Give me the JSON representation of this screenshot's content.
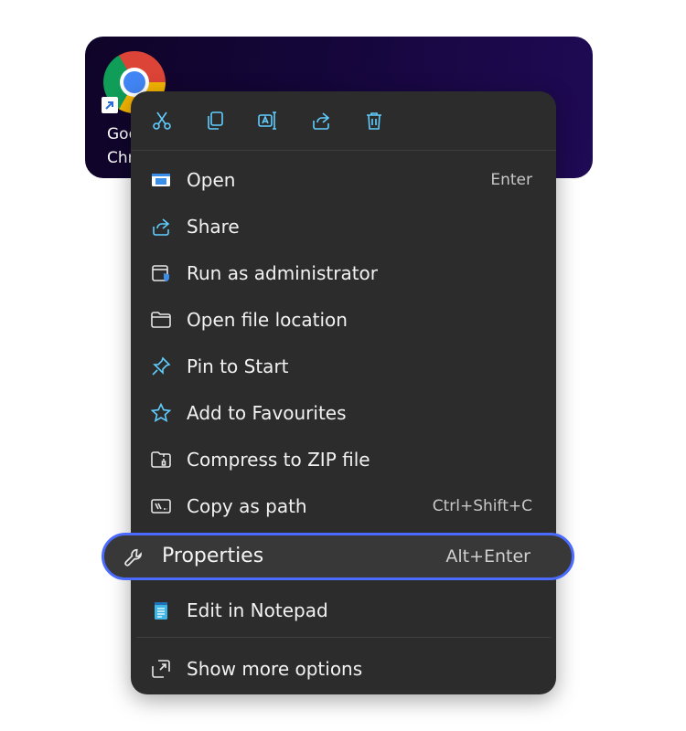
{
  "desktop": {
    "icon_name": "chrome-icon",
    "label_line1": "Goo",
    "label_line2": "Chr"
  },
  "quick_actions": [
    {
      "name": "cut",
      "icon": "scissors-icon"
    },
    {
      "name": "copy",
      "icon": "copy-icon"
    },
    {
      "name": "rename",
      "icon": "rename-icon"
    },
    {
      "name": "share",
      "icon": "share-icon"
    },
    {
      "name": "delete",
      "icon": "trash-icon"
    }
  ],
  "menu": {
    "open": {
      "label": "Open",
      "shortcut": "Enter"
    },
    "share": {
      "label": "Share"
    },
    "run_admin": {
      "label": "Run as administrator"
    },
    "open_location": {
      "label": "Open file location"
    },
    "pin_start": {
      "label": "Pin to Start"
    },
    "add_fav": {
      "label": "Add to Favourites"
    },
    "compress": {
      "label": "Compress to ZIP file"
    },
    "copy_path": {
      "label": "Copy as path",
      "shortcut": "Ctrl+Shift+C"
    },
    "properties": {
      "label": "Properties",
      "shortcut": "Alt+Enter"
    },
    "notepad": {
      "label": "Edit in Notepad"
    },
    "more": {
      "label": "Show more options"
    }
  },
  "colors": {
    "menu_bg": "#2c2c2c",
    "accent_icon": "#60cdff",
    "highlight_border": "#4b6bff"
  }
}
